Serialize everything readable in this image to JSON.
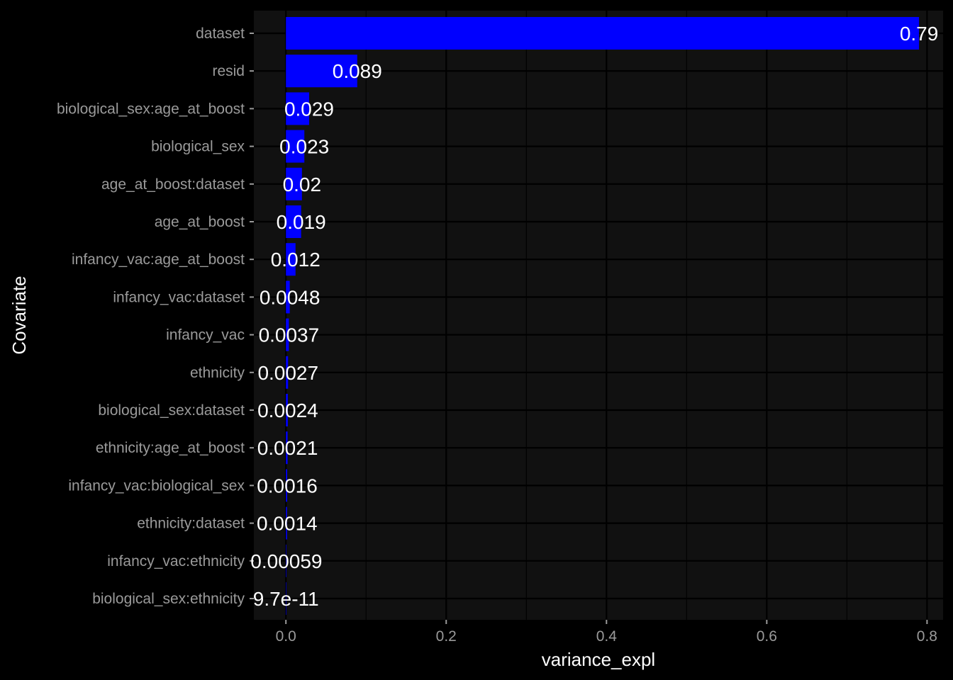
{
  "chart_data": {
    "type": "bar",
    "orientation": "horizontal",
    "xlabel": "variance_expl",
    "ylabel": "Covariate",
    "xlim": [
      -0.04,
      0.82
    ],
    "x_ticks": [
      0.0,
      0.2,
      0.4,
      0.6,
      0.8
    ],
    "x_tick_labels": [
      "0.0",
      "0.2",
      "0.4",
      "0.6",
      "0.8"
    ],
    "grid": true,
    "legend": "none",
    "colors": {
      "bar": "#0000ff",
      "panel": "#111111",
      "background": "#000000",
      "grid": "#000000"
    },
    "categories": [
      "dataset",
      "resid",
      "biological_sex:age_at_boost",
      "biological_sex",
      "age_at_boost:dataset",
      "age_at_boost",
      "infancy_vac:age_at_boost",
      "infancy_vac:dataset",
      "infancy_vac",
      "ethnicity",
      "biological_sex:dataset",
      "ethnicity:age_at_boost",
      "infancy_vac:biological_sex",
      "ethnicity:dataset",
      "infancy_vac:ethnicity",
      "biological_sex:ethnicity"
    ],
    "values": [
      0.79,
      0.089,
      0.029,
      0.023,
      0.02,
      0.019,
      0.012,
      0.0048,
      0.0037,
      0.0027,
      0.0024,
      0.0021,
      0.0016,
      0.0014,
      0.00059,
      9.7e-11
    ],
    "value_labels": [
      "0.79",
      "0.089",
      "0.029",
      "0.023",
      "0.02",
      "0.019",
      "0.012",
      "0.0048",
      "0.0037",
      "0.0027",
      "0.0024",
      "0.0021",
      "0.0016",
      "0.0014",
      "0.00059",
      "9.7e-11"
    ]
  }
}
